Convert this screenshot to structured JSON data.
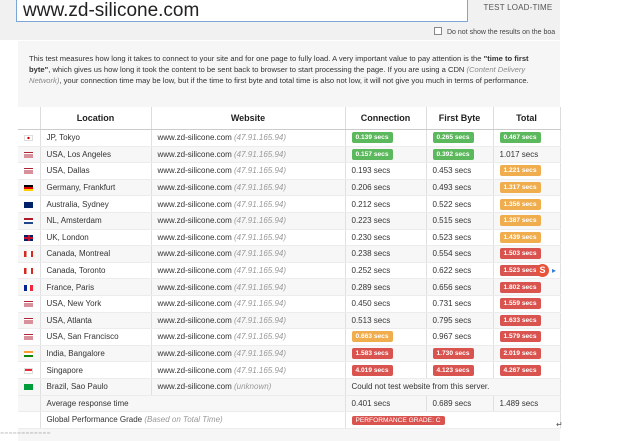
{
  "header": {
    "url_value": "www.zd-silicone.com",
    "test_button": "TEST LOAD-TIME",
    "checkbox_label": "Do not show the results on the boa"
  },
  "description": {
    "part1": "This test measures how long it takes to connect to your site and for one page to fully load. A very important value to pay attention is the ",
    "bold": "\"time to first byte\"",
    "part2": ", which gives us how long it took the content to be sent back to browser to start processing the page. If you are using a CDN ",
    "italic": "(Content Delivery Network)",
    "part3": ", your connection time may be low, but if the time to first byte and total time is also not low, it will not give you much in terms of performance."
  },
  "table": {
    "headers": {
      "location": "Location",
      "website": "Website",
      "connection": "Connection",
      "first_byte": "First Byte",
      "total": "Total"
    },
    "rows": [
      {
        "flag": "jp",
        "location": "JP, Tokyo",
        "site": "www.zd-silicone.com",
        "ip": "(47.91.165.94)",
        "connection": "0.139 secs",
        "connection_color": "g",
        "first_byte": "0.265 secs",
        "first_byte_color": "g",
        "total": "0.467 secs",
        "total_color": "g"
      },
      {
        "flag": "us",
        "location": "USA, Los Angeles",
        "site": "www.zd-silicone.com",
        "ip": "(47.91.165.94)",
        "connection": "0.157 secs",
        "connection_color": "g",
        "first_byte": "0.392 secs",
        "first_byte_color": "g",
        "total": "1.017 secs",
        "total_color": ""
      },
      {
        "flag": "us",
        "location": "USA, Dallas",
        "site": "www.zd-silicone.com",
        "ip": "(47.91.165.94)",
        "connection": "0.193 secs",
        "connection_color": "",
        "first_byte": "0.453 secs",
        "first_byte_color": "",
        "total": "1.221 secs",
        "total_color": "o"
      },
      {
        "flag": "de",
        "location": "Germany, Frankfurt",
        "site": "www.zd-silicone.com",
        "ip": "(47.91.165.94)",
        "connection": "0.206 secs",
        "connection_color": "",
        "first_byte": "0.493 secs",
        "first_byte_color": "",
        "total": "1.317 secs",
        "total_color": "o"
      },
      {
        "flag": "au",
        "location": "Australia, Sydney",
        "site": "www.zd-silicone.com",
        "ip": "(47.91.165.94)",
        "connection": "0.212 secs",
        "connection_color": "",
        "first_byte": "0.522 secs",
        "first_byte_color": "",
        "total": "1.356 secs",
        "total_color": "o"
      },
      {
        "flag": "nl",
        "location": "NL, Amsterdam",
        "site": "www.zd-silicone.com",
        "ip": "(47.91.165.94)",
        "connection": "0.223 secs",
        "connection_color": "",
        "first_byte": "0.515 secs",
        "first_byte_color": "",
        "total": "1.387 secs",
        "total_color": "o"
      },
      {
        "flag": "uk",
        "location": "UK, London",
        "site": "www.zd-silicone.com",
        "ip": "(47.91.165.94)",
        "connection": "0.230 secs",
        "connection_color": "",
        "first_byte": "0.523 secs",
        "first_byte_color": "",
        "total": "1.439 secs",
        "total_color": "o"
      },
      {
        "flag": "ca",
        "location": "Canada, Montreal",
        "site": "www.zd-silicone.com",
        "ip": "(47.91.165.94)",
        "connection": "0.238 secs",
        "connection_color": "",
        "first_byte": "0.554 secs",
        "first_byte_color": "",
        "total": "1.503 secs",
        "total_color": "r"
      },
      {
        "flag": "ca",
        "location": "Canada, Toronto",
        "site": "www.zd-silicone.com",
        "ip": "(47.91.165.94)",
        "connection": "0.252 secs",
        "connection_color": "",
        "first_byte": "0.622 secs",
        "first_byte_color": "",
        "total": "1.523 secs",
        "total_color": "r"
      },
      {
        "flag": "fr",
        "location": "France, Paris",
        "site": "www.zd-silicone.com",
        "ip": "(47.91.165.94)",
        "connection": "0.289 secs",
        "connection_color": "",
        "first_byte": "0.656 secs",
        "first_byte_color": "",
        "total": "1.802 secs",
        "total_color": "r"
      },
      {
        "flag": "us",
        "location": "USA, New York",
        "site": "www.zd-silicone.com",
        "ip": "(47.91.165.94)",
        "connection": "0.450 secs",
        "connection_color": "",
        "first_byte": "0.731 secs",
        "first_byte_color": "",
        "total": "1.559 secs",
        "total_color": "r"
      },
      {
        "flag": "us",
        "location": "USA, Atlanta",
        "site": "www.zd-silicone.com",
        "ip": "(47.91.165.94)",
        "connection": "0.513 secs",
        "connection_color": "",
        "first_byte": "0.795 secs",
        "first_byte_color": "",
        "total": "1.633 secs",
        "total_color": "r"
      },
      {
        "flag": "us",
        "location": "USA, San Francisco",
        "site": "www.zd-silicone.com",
        "ip": "(47.91.165.94)",
        "connection": "0.663 secs",
        "connection_color": "o",
        "first_byte": "0.967 secs",
        "first_byte_color": "",
        "total": "1.579 secs",
        "total_color": "r"
      },
      {
        "flag": "in",
        "location": "India, Bangalore",
        "site": "www.zd-silicone.com",
        "ip": "(47.91.165.94)",
        "connection": "1.583 secs",
        "connection_color": "r",
        "first_byte": "1.730 secs",
        "first_byte_color": "r",
        "total": "2.019 secs",
        "total_color": "r"
      },
      {
        "flag": "sg",
        "location": "Singapore",
        "site": "www.zd-silicone.com",
        "ip": "(47.91.165.94)",
        "connection": "4.019 secs",
        "connection_color": "r",
        "first_byte": "4.123 secs",
        "first_byte_color": "r",
        "total": "4.267 secs",
        "total_color": "r"
      },
      {
        "flag": "br",
        "location": "Brazil, Sao Paulo",
        "site": "www.zd-silicone.com",
        "ip": "(unknown)",
        "error": "Could not test website from this server."
      }
    ],
    "average": {
      "label": "Average response time",
      "connection": "0.401 secs",
      "first_byte": "0.689 secs",
      "total": "1.489 secs"
    },
    "grade": {
      "label": "Global Performance Grade",
      "note": "(Based on Total Time)",
      "badge": "PERFORMANCE GRADE: C"
    }
  },
  "overlay": {
    "s_icon": "S",
    "enter_mark": "↵"
  }
}
